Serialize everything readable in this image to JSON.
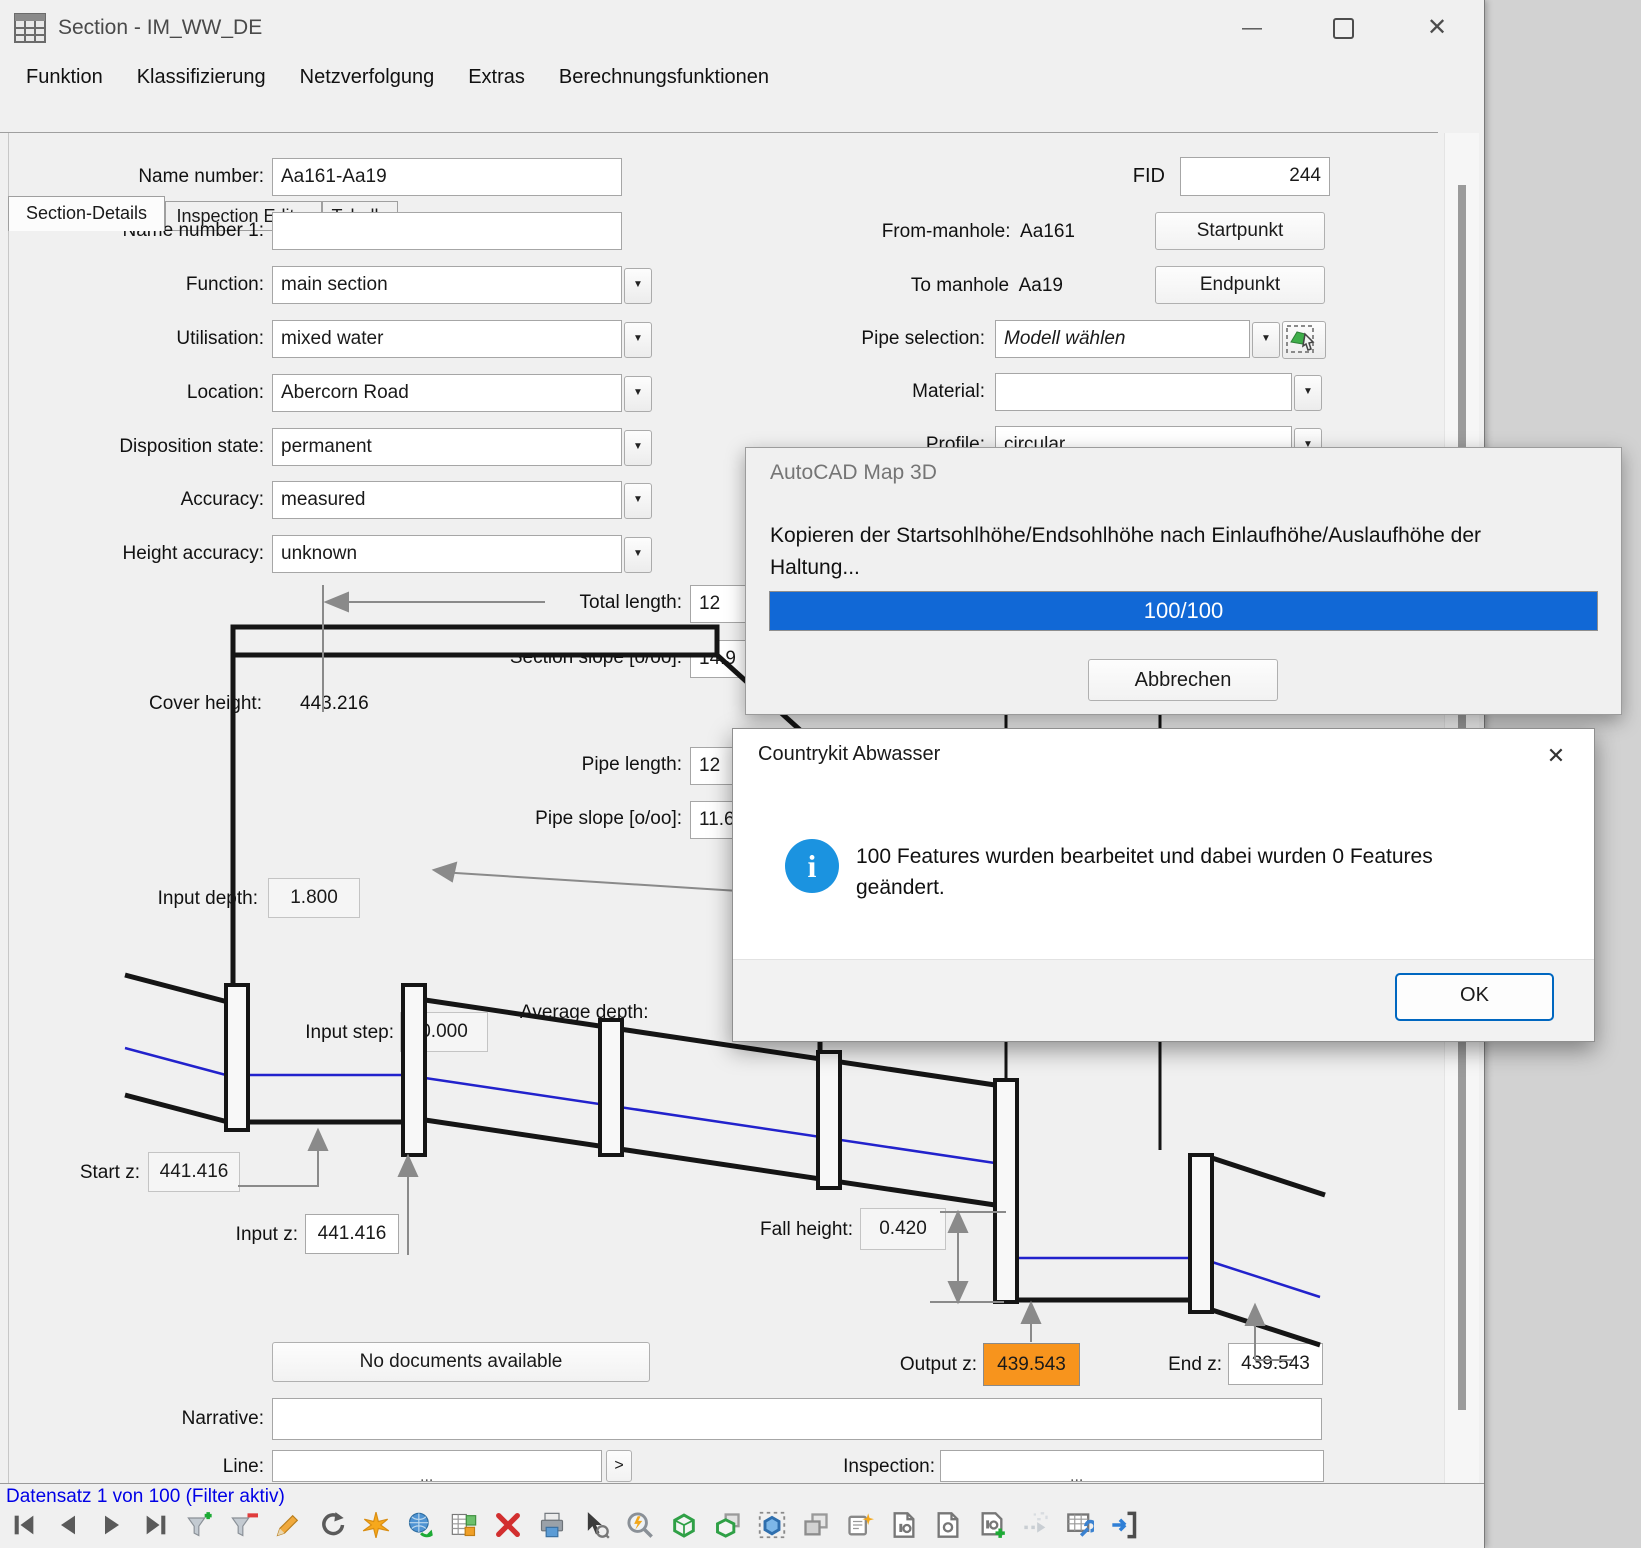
{
  "window": {
    "title": "Section - IM_WW_DE"
  },
  "menu": {
    "items": [
      "Funktion",
      "Klassifizierung",
      "Netzverfolgung",
      "Extras",
      "Berechnungsfunktionen"
    ]
  },
  "tabs": {
    "tab1": "Section-Details",
    "tab2": "Inspection Editor",
    "tab3": "Tabelle"
  },
  "form": {
    "name_number": {
      "label": "Name number:",
      "value": "Aa161-Aa19"
    },
    "name_number1": {
      "label": "Name number 1:",
      "value": ""
    },
    "function": {
      "label": "Function:",
      "value": "main section"
    },
    "utilisation": {
      "label": "Utilisation:",
      "value": "mixed water"
    },
    "location": {
      "label": "Location:",
      "value": "Abercorn Road"
    },
    "disposition": {
      "label": "Disposition state:",
      "value": "permanent"
    },
    "accuracy": {
      "label": "Accuracy:",
      "value": "measured"
    },
    "height_accuracy": {
      "label": "Height accuracy:",
      "value": "unknown"
    },
    "fid": {
      "label": "FID",
      "value": "244"
    },
    "from_manhole": {
      "label": "From-manhole:",
      "value": "Aa161",
      "button": "Startpunkt"
    },
    "to_manhole": {
      "label": "To manhole",
      "value": "Aa19",
      "button": "Endpunkt"
    },
    "pipe_selection": {
      "label": "Pipe selection:",
      "value": "Modell wählen"
    },
    "material": {
      "label": "Material:",
      "value": ""
    },
    "profile": {
      "label": "Profile:",
      "value": "circular"
    },
    "total_length": {
      "label": "Total length:",
      "value": "12"
    },
    "section_slope": {
      "label": "Section slope [o/oo]:",
      "value": "14.9"
    },
    "pipe_length": {
      "label": "Pipe length:",
      "value": "12"
    },
    "pipe_slope": {
      "label": "Pipe slope [o/oo]:",
      "value": "11.6"
    },
    "average_depth": {
      "label": "Average depth:"
    },
    "documents_button": "No documents available",
    "narrative": {
      "label": "Narrative:",
      "value": ""
    },
    "line": {
      "label": "Line:",
      "value": "",
      "more_label": ">",
      "ellipsis": "..."
    },
    "inspection": {
      "label": "Inspection:",
      "value": "",
      "ellipsis": "..."
    }
  },
  "diagram": {
    "cover_height": {
      "label": "Cover height:",
      "value": "443.216"
    },
    "input_depth": {
      "label": "Input depth:",
      "value": "1.800"
    },
    "input_step": {
      "label": "Input step:",
      "value": "0.000"
    },
    "start_z": {
      "label": "Start z:",
      "value": "441.416"
    },
    "input_z": {
      "label": "Input z:",
      "value": "441.416"
    },
    "fall_height": {
      "label": "Fall height:",
      "value": "0.420"
    },
    "output_z": {
      "label": "Output z:",
      "value": "439.543",
      "highlight_color": "#F7941D"
    },
    "end_z": {
      "label": "End z:",
      "value": "439.543"
    }
  },
  "progress_dialog": {
    "title": "AutoCAD Map 3D",
    "message": "Kopieren der Startsohlhöhe/Endsohlhöhe nach Einlaufhöhe/Auslaufhöhe der Haltung...",
    "progress_text": "100/100",
    "progress_color": "#1168d6",
    "cancel_label": "Abbrechen"
  },
  "message_dialog": {
    "title": "Countrykit Abwasser",
    "message": "100 Features wurden bearbeitet und dabei wurden 0 Features geändert.",
    "ok_label": "OK",
    "info_color": "#1B93E0"
  },
  "statusbar": {
    "text": "Datensatz 1 von 100 (Filter aktiv)",
    "color": "#0000E6"
  },
  "toolbar": {
    "icons": [
      "nav-first",
      "nav-prev",
      "nav-next",
      "nav-last",
      "filter-add",
      "filter-remove",
      "edit-pencil",
      "refresh",
      "flash-new",
      "globe-sync",
      "table-export",
      "delete",
      "print",
      "select-inspect",
      "zoom-flash",
      "polygon",
      "polygon-copy",
      "polygon-select",
      "copy-gray",
      "note-new",
      "doc-photo",
      "doc-view",
      "doc-add",
      "move-disabled",
      "table-tools",
      "exit"
    ]
  }
}
